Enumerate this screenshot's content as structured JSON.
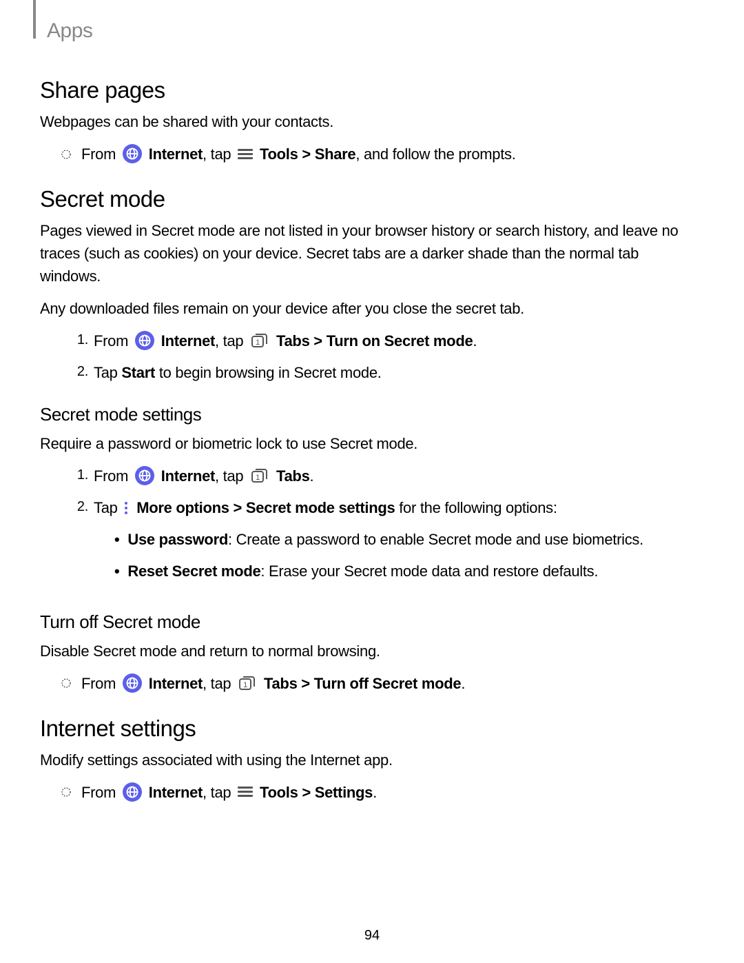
{
  "header": {
    "label": "Apps"
  },
  "sections": {
    "sharePages": {
      "title": "Share pages",
      "desc": "Webpages can be shared with your contacts.",
      "step": {
        "prefix": "From ",
        "internet": "Internet",
        "tap": ", tap ",
        "tools": "Tools",
        "gt": " > ",
        "share": "Share",
        "suffix": ", and follow the prompts."
      }
    },
    "secretMode": {
      "title": "Secret mode",
      "p1": "Pages viewed in Secret mode are not listed in your browser history or search history, and leave no traces (such as cookies) on your device. Secret tabs are a darker shade than the normal tab windows.",
      "p2": "Any downloaded files remain on your device after you close the secret tab.",
      "step1": {
        "prefix": "From ",
        "internet": "Internet",
        "tap": ", tap ",
        "tabs": "Tabs",
        "gt": " > ",
        "turnon": "Turn on Secret mode",
        "suffix": "."
      },
      "step2": {
        "tapPrefix": "Tap ",
        "start": "Start",
        "suffix": " to begin browsing in Secret mode."
      }
    },
    "secretSettings": {
      "title": "Secret mode settings",
      "desc": "Require a password or biometric lock to use Secret mode.",
      "s1": {
        "prefix": "From ",
        "internet": "Internet",
        "tap": ", tap ",
        "tabs": "Tabs",
        "suffix": "."
      },
      "s2": {
        "tapPrefix": "Tap ",
        "more": "More options",
        "gt": " > ",
        "sms": "Secret mode settings",
        "suffix": " for the following options:"
      },
      "opt1": {
        "label": "Use password",
        "desc": ": Create a password to enable Secret mode and use biometrics."
      },
      "opt2": {
        "label": "Reset Secret mode",
        "desc": ": Erase your Secret mode data and restore defaults."
      }
    },
    "turnOff": {
      "title": "Turn off Secret mode",
      "desc": "Disable Secret mode and return to normal browsing.",
      "step": {
        "prefix": "From ",
        "internet": "Internet",
        "tap": ", tap ",
        "tabs": "Tabs",
        "gt": " > ",
        "off": "Turn off Secret mode",
        "suffix": "."
      }
    },
    "internetSettings": {
      "title": "Internet settings",
      "desc": "Modify settings associated with using the Internet app.",
      "step": {
        "prefix": "From ",
        "internet": "Internet",
        "tap": ", tap ",
        "tools": "Tools",
        "gt": " > ",
        "settings": "Settings",
        "suffix": "."
      }
    }
  },
  "pageNumber": "94"
}
